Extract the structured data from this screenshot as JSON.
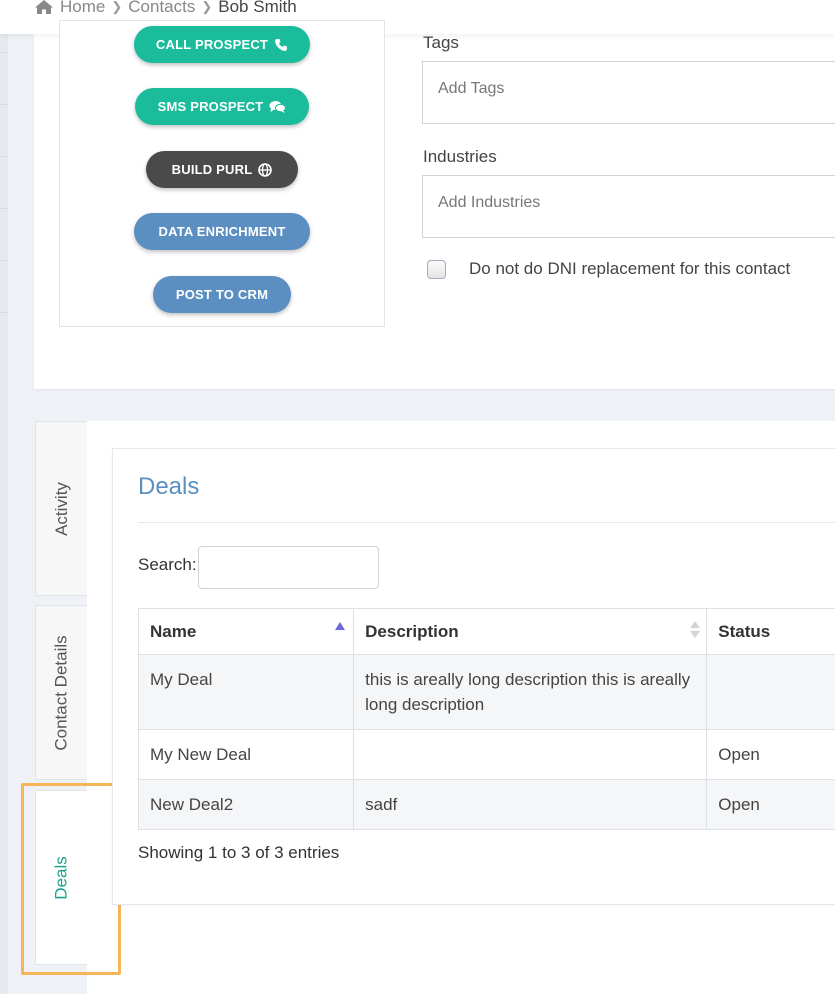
{
  "breadcrumb": {
    "home": "Home",
    "contacts": "Contacts",
    "current": "Bob Smith"
  },
  "actions": {
    "call": "CALL PROSPECT",
    "sms": "SMS PROSPECT",
    "purl": "BUILD PURL",
    "enrich": "DATA ENRICHMENT",
    "crm": "POST TO CRM"
  },
  "form": {
    "tags_label": "Tags",
    "tags_placeholder": "Add Tags",
    "industries_label": "Industries",
    "industries_placeholder": "Add Industries",
    "dni_label": "Do not do DNI replacement for this contact",
    "dni_checked": false
  },
  "tabs": [
    {
      "label": "Activity"
    },
    {
      "label": "Contact Details"
    },
    {
      "label": "Deals"
    }
  ],
  "deals": {
    "title": "Deals",
    "search_label": "Search:",
    "search_value": "",
    "columns": [
      "Name",
      "Description",
      "Status"
    ],
    "rows": [
      {
        "name": "My Deal",
        "description": "this is areally long description this is areally long description",
        "status": ""
      },
      {
        "name": "My New Deal",
        "description": "",
        "status": "Open"
      },
      {
        "name": "New Deal2",
        "description": "sadf",
        "status": "Open"
      }
    ],
    "info": "Showing 1 to 3 of 3 entries"
  },
  "colors": {
    "teal": "#1abc9c",
    "dark": "#4a4a4a",
    "blue": "#5b8fc2",
    "active_tab_text": "#1aa38a",
    "highlight": "#f6b559"
  }
}
